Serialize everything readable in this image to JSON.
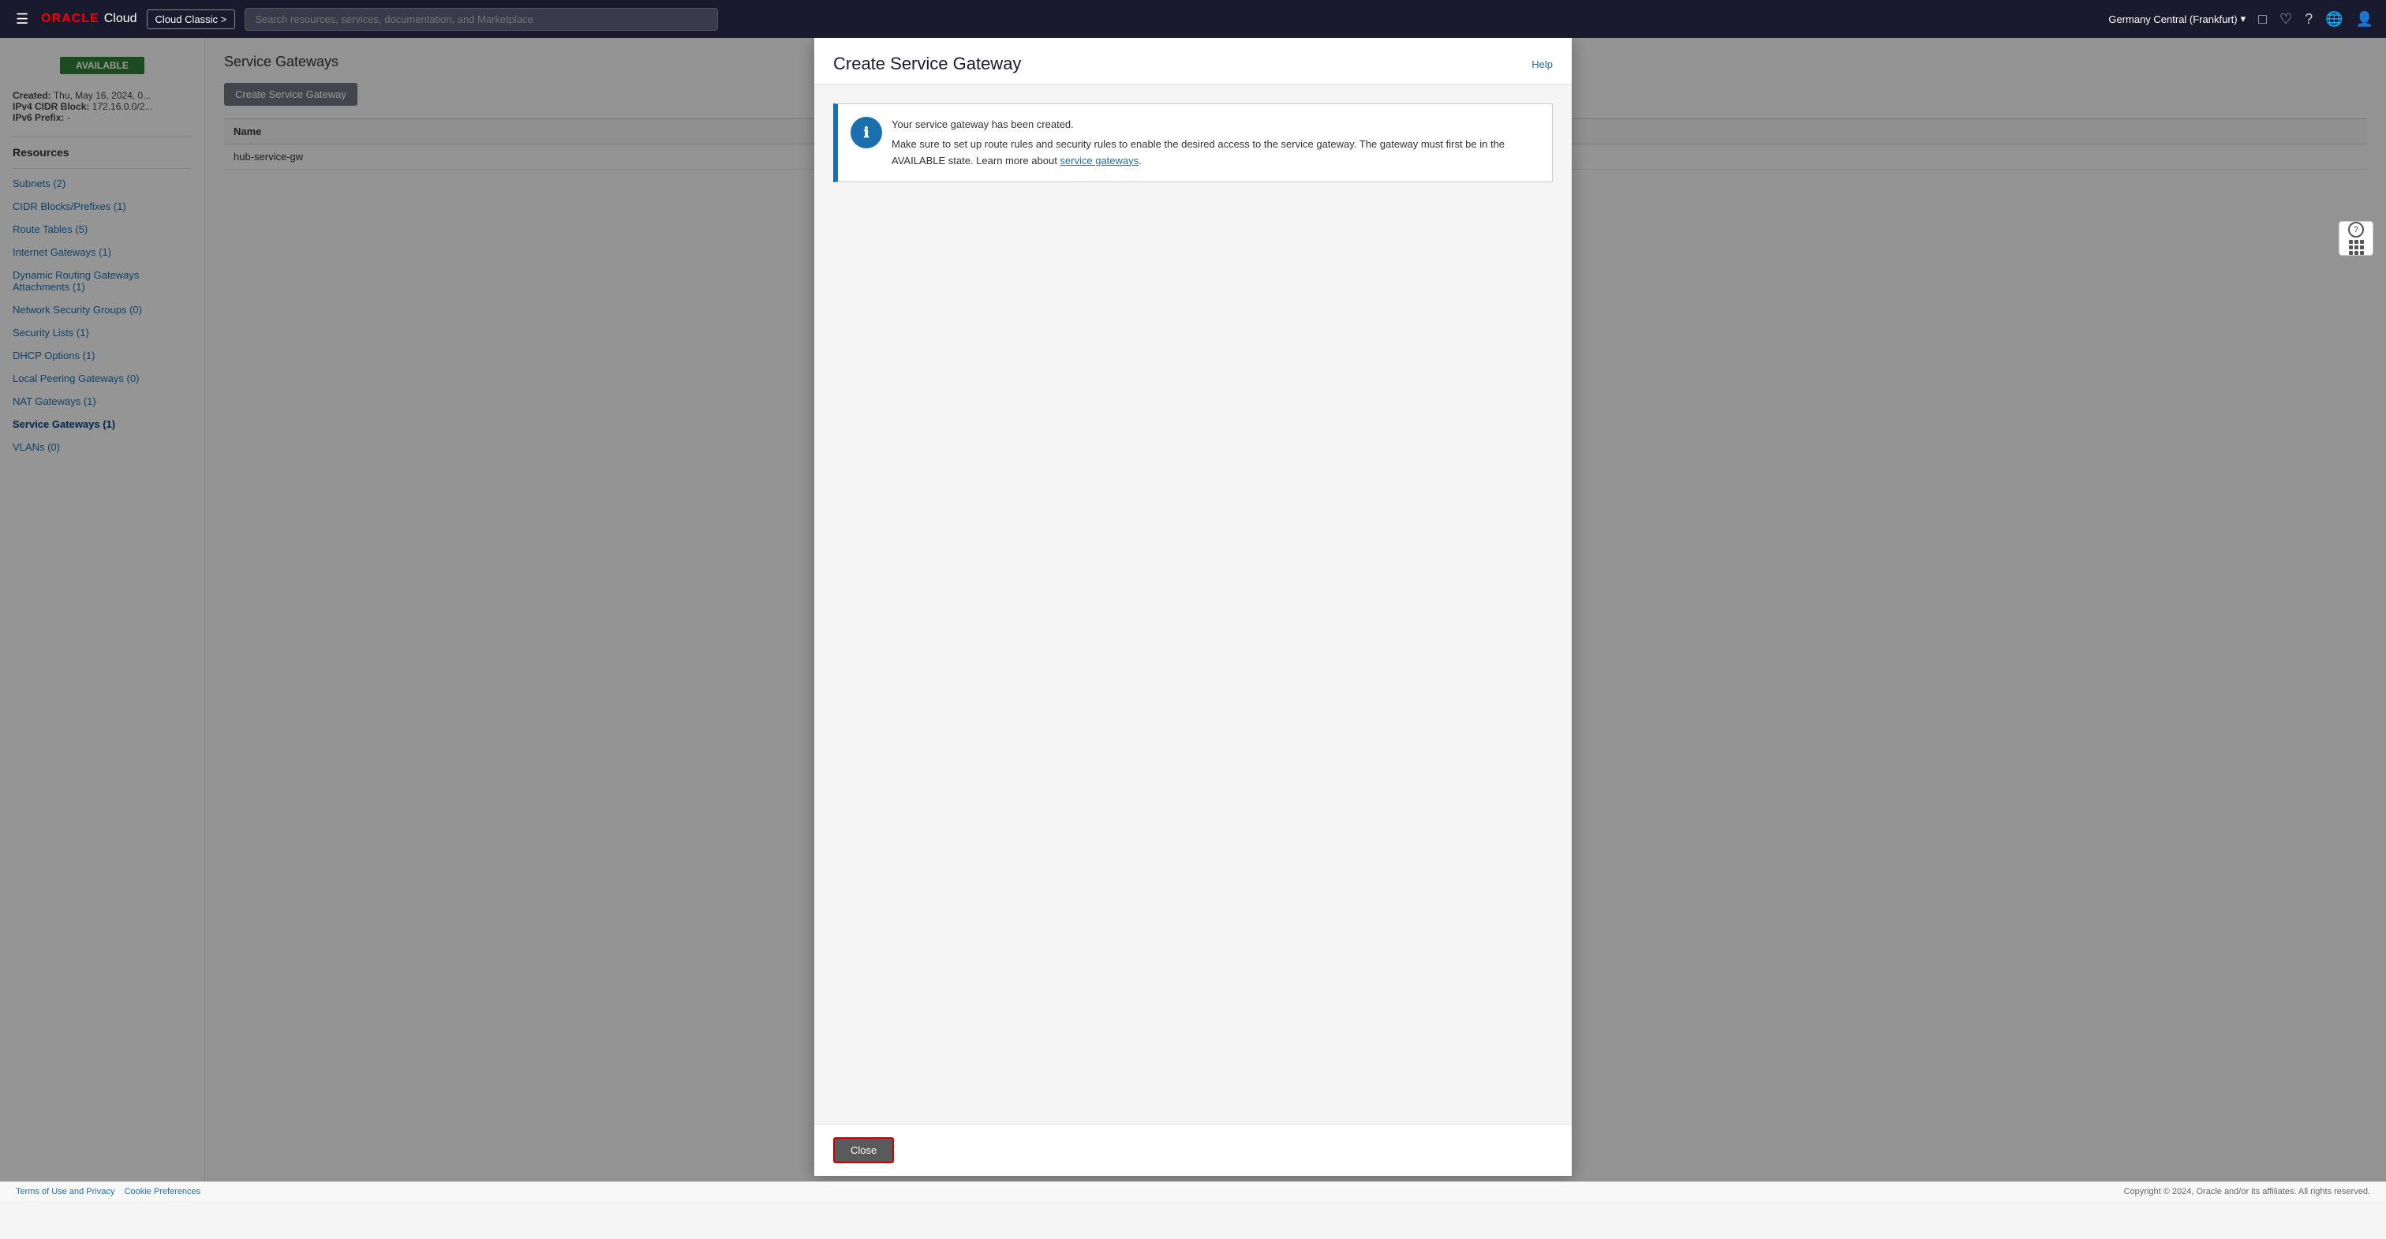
{
  "topnav": {
    "oracle_text": "ORACLE",
    "cloud_text": "Cloud",
    "cloud_classic_label": "Cloud Classic >",
    "search_placeholder": "Search resources, services, documentation, and Marketplace",
    "region_label": "Germany Central (Frankfurt)",
    "region_chevron": "▾"
  },
  "sidebar": {
    "status_label": "AVAILABLE",
    "info": {
      "created_label": "Created:",
      "created_value": "Thu, May 16, 2024, 0...",
      "ipv4_label": "IPv4 CIDR Block:",
      "ipv4_value": "172.16.0.0/2...",
      "ipv6_label": "IPv6 Prefix:",
      "ipv6_value": "-"
    },
    "resources_title": "Resources",
    "nav_items": [
      {
        "label": "Subnets (2)",
        "active": false,
        "id": "subnets"
      },
      {
        "label": "CIDR Blocks/Prefixes (1)",
        "active": false,
        "id": "cidr-blocks"
      },
      {
        "label": "Route Tables (5)",
        "active": false,
        "id": "route-tables"
      },
      {
        "label": "Internet Gateways (1)",
        "active": false,
        "id": "internet-gateways"
      },
      {
        "label": "Dynamic Routing Gateways Attachments (1)",
        "active": false,
        "id": "drg-attachments"
      },
      {
        "label": "Network Security Groups (0)",
        "active": false,
        "id": "nsg"
      },
      {
        "label": "Security Lists (1)",
        "active": false,
        "id": "security-lists"
      },
      {
        "label": "DHCP Options (1)",
        "active": false,
        "id": "dhcp-options"
      },
      {
        "label": "Local Peering Gateways (0)",
        "active": false,
        "id": "local-peering"
      },
      {
        "label": "NAT Gateways (1)",
        "active": false,
        "id": "nat-gateways"
      },
      {
        "label": "Service Gateways (1)",
        "active": true,
        "id": "service-gateways"
      },
      {
        "label": "VLANs (0)",
        "active": false,
        "id": "vlans"
      }
    ]
  },
  "content": {
    "section_title": "Service Gateways",
    "create_button": "Create Service Gateway",
    "table_headers": [
      "Name"
    ],
    "table_rows": [
      {
        "name": "hub-service-gw"
      }
    ]
  },
  "modal": {
    "title": "Create Service Gateway",
    "help_link": "Help",
    "alert": {
      "icon": "ℹ",
      "title": "Your service gateway has been created.",
      "body": "Make sure to set up route rules and security rules to enable the desired access to the service gateway. The gateway must first be in the AVAILABLE state. Learn more about ",
      "link_text": "service gateways",
      "link_suffix": "."
    },
    "close_button": "Close"
  },
  "footer": {
    "left_links": [
      {
        "label": "Terms of Use and Privacy"
      },
      {
        "label": "Cookie Preferences"
      }
    ],
    "right_text": "Copyright © 2024, Oracle and/or its affiliates. All rights reserved."
  }
}
